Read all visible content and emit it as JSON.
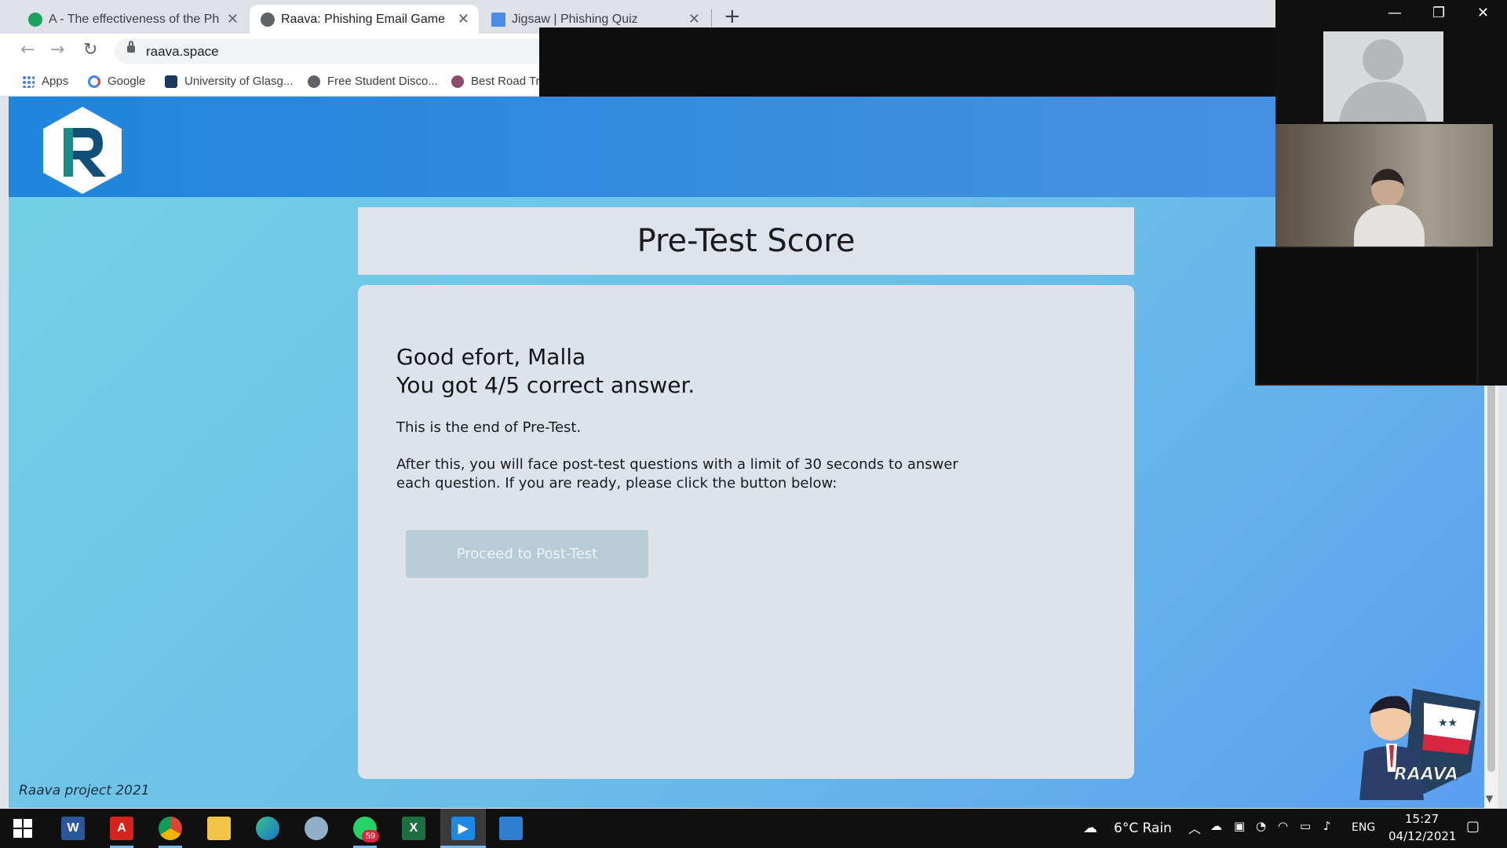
{
  "browser": {
    "tabs": [
      {
        "title": "A - The effectiveness of the Phish",
        "active": false
      },
      {
        "title": "Raava: Phishing Email Game",
        "active": true
      },
      {
        "title": "Jigsaw | Phishing Quiz",
        "active": false
      }
    ],
    "url": "raava.space",
    "bookmarks": [
      {
        "label": "Apps"
      },
      {
        "label": "Google"
      },
      {
        "label": "University of Glasg..."
      },
      {
        "label": "Free Student Disco..."
      },
      {
        "label": "Best Road Tri"
      }
    ]
  },
  "page": {
    "score_title": "Pre-Test Score",
    "greeting_line1": "Good efort, Malla",
    "greeting_line2": "You got 4/5 correct answer.",
    "end_text": "This is the end of Pre-Test.",
    "instructions": "After this, you will face post-test questions with a limit of 30 seconds to answer each question. If you are ready, please click the button below:",
    "proceed_label": "Proceed to Post-Test",
    "footer": "Raava project 2021",
    "mascot_text": "RAAVA"
  },
  "taskbar": {
    "whatsapp_badge": "59",
    "weather": "6°C  Rain",
    "language": "ENG",
    "time": "15:27",
    "date": "04/12/2021"
  },
  "colors": {
    "header_blue": "#1f85dd",
    "page_bg": "#6cbde8",
    "card_bg": "#dde3ea",
    "button_disabled": "#b8ccd8"
  }
}
